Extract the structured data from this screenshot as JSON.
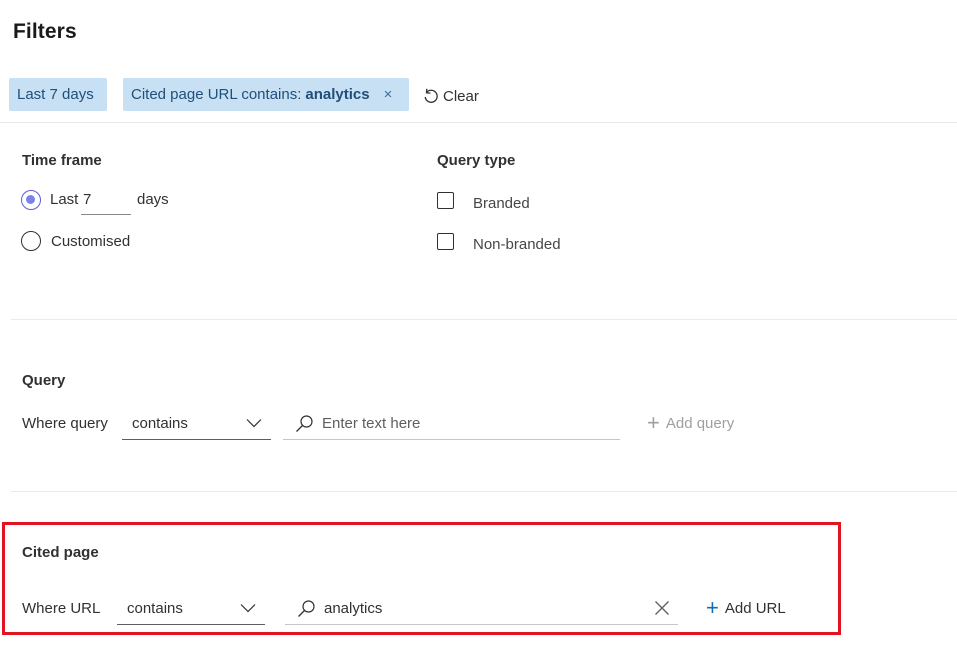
{
  "header": {
    "title": "Filters"
  },
  "chips": {
    "time_chip": "Last 7 days",
    "url_chip_prefix": "Cited page URL contains:",
    "url_chip_value": "analytics",
    "close_glyph": "×",
    "clear_label": "Clear",
    "clear_icon": "undo-icon"
  },
  "time_frame": {
    "heading": "Time frame",
    "last_label": "Last",
    "days_value": "7",
    "days_label": "days",
    "customised_label": "Customised",
    "selected": "last"
  },
  "query_type": {
    "heading": "Query type",
    "options": [
      {
        "label": "Branded",
        "checked": false
      },
      {
        "label": "Non-branded",
        "checked": false
      }
    ]
  },
  "query": {
    "heading": "Query",
    "where_label": "Where query",
    "operator": "contains",
    "placeholder": "Enter text here",
    "value": "",
    "add_label": "Add query"
  },
  "cited_page": {
    "heading": "Cited page",
    "where_label": "Where URL",
    "operator": "contains",
    "value": "analytics",
    "add_label": "Add URL"
  },
  "colors": {
    "chip_bg": "#c7e0f4",
    "radio_accent": "#7b83eb",
    "link_blue": "#0f6cbd",
    "highlight": "#e3141f"
  }
}
